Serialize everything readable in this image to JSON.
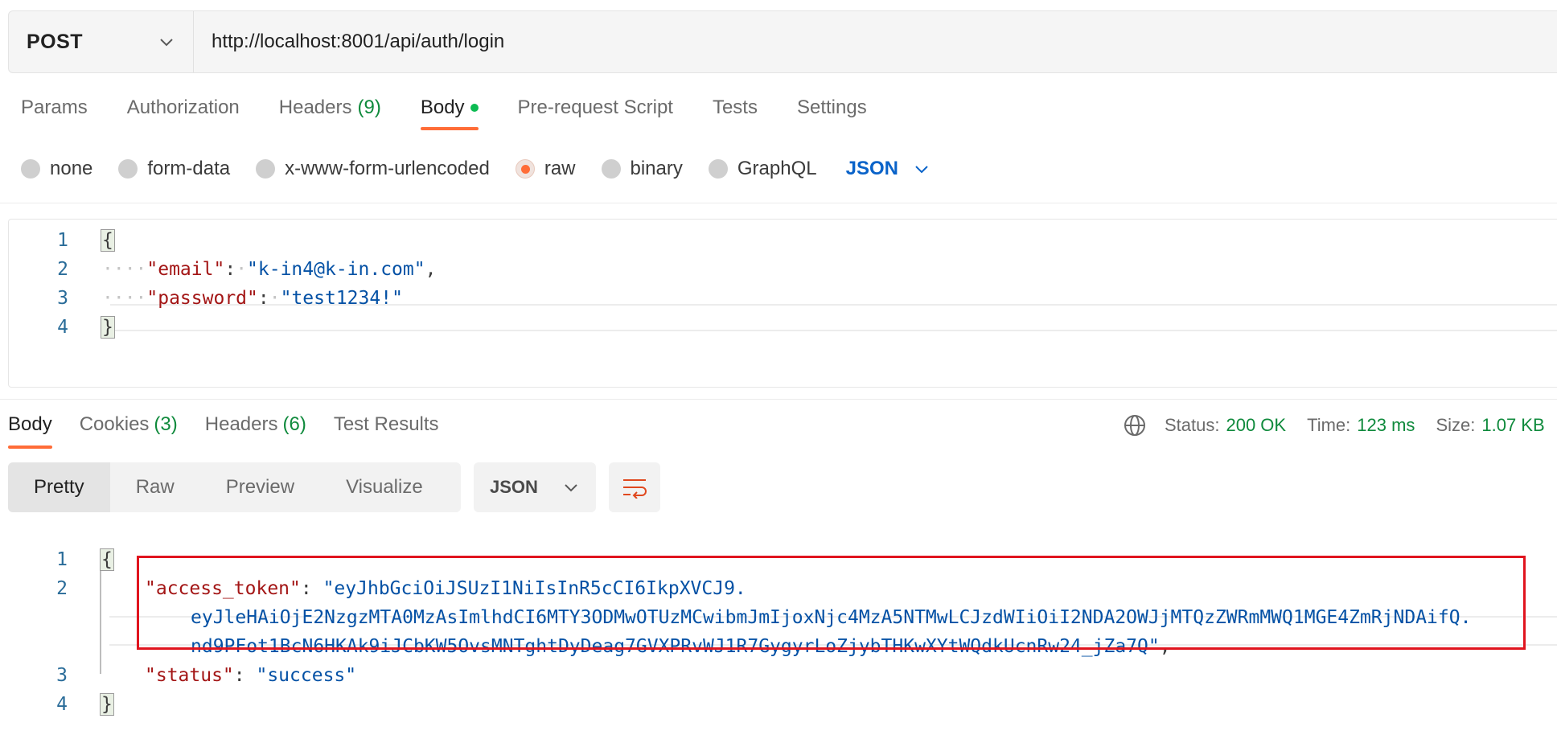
{
  "request": {
    "method": "POST",
    "url": "http://localhost:8001/api/auth/login"
  },
  "request_tabs": [
    {
      "label": "Params",
      "count": ""
    },
    {
      "label": "Authorization",
      "count": ""
    },
    {
      "label": "Headers",
      "count": "(9)"
    },
    {
      "label": "Body",
      "count": ""
    },
    {
      "label": "Pre-request Script",
      "count": ""
    },
    {
      "label": "Tests",
      "count": ""
    },
    {
      "label": "Settings",
      "count": ""
    }
  ],
  "body_types": {
    "none": "none",
    "form_data": "form-data",
    "urlencoded": "x-www-form-urlencoded",
    "raw": "raw",
    "binary": "binary",
    "graphql": "GraphQL",
    "language": "JSON"
  },
  "request_body": {
    "line_numbers": [
      "1",
      "2",
      "3",
      "4"
    ],
    "open_brace": "{",
    "close_brace": "}",
    "email_key": "\"email\"",
    "email_value": "\"k-in4@k-in.com\"",
    "password_key": "\"password\"",
    "password_value": "\"test1234!\""
  },
  "response_tabs": {
    "body": "Body",
    "cookies": "Cookies",
    "cookies_count": "(3)",
    "headers": "Headers",
    "headers_count": "(6)",
    "test_results": "Test Results"
  },
  "response_status": {
    "status_label": "Status:",
    "status_value": "200 OK",
    "time_label": "Time:",
    "time_value": "123 ms",
    "size_label": "Size:",
    "size_value": "1.07 KB"
  },
  "view_modes": {
    "pretty": "Pretty",
    "raw": "Raw",
    "preview": "Preview",
    "visualize": "Visualize",
    "format": "JSON"
  },
  "response_body": {
    "line_numbers": [
      "1",
      "2",
      "3",
      "4"
    ],
    "open_brace": "{",
    "close_brace": "}",
    "token_key": "\"access_token\"",
    "token_part1": "\"eyJhbGciOiJSUzI1NiIsInR5cCI6IkpXVCJ9.",
    "token_part2": "eyJleHAiOjE2NzgzMTA0MzAsImlhdCI6MTY3ODMwOTUzMCwibmJmIjoxNjc4MzA5NTMwLCJzdWIiOiI2NDA2OWJjMTQzZWRmMWQ1MGE4ZmRjNDAifQ.",
    "token_part3": "nd9PFot1BcN6HKAk9iJCbKW5OvsMNTghtDyDeag7GVXPRvWJ1R7GygyrLoZjybTHKwXYtWQdkUcnRw24_jZa7Q\"",
    "status_key": "\"status\"",
    "status_value": "\"success\""
  },
  "colors": {
    "accent": "#ff6c37",
    "success": "#0f8a3c",
    "link_blue": "#0a63c9",
    "highlight_red": "#e0141e"
  }
}
